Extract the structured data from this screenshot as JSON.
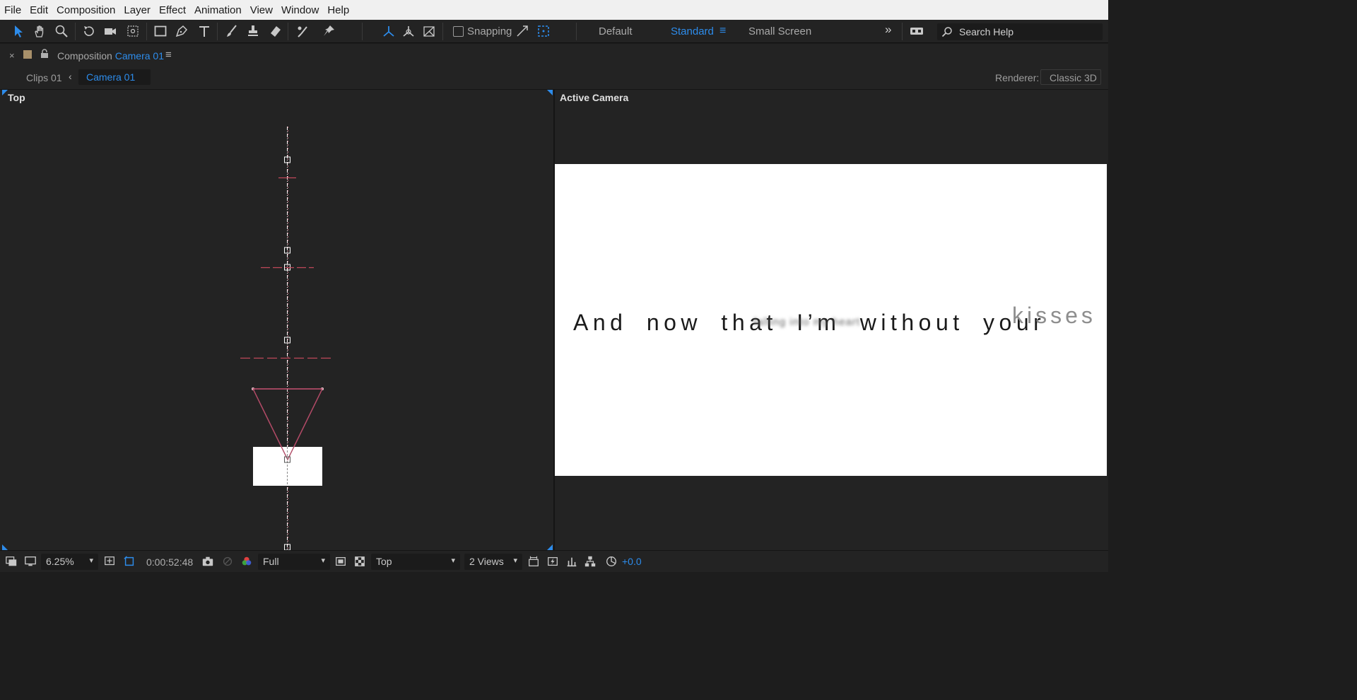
{
  "menu": [
    "File",
    "Edit",
    "Composition",
    "Layer",
    "Effect",
    "Animation",
    "View",
    "Window",
    "Help"
  ],
  "toolbar": {
    "snapping_label": "Snapping",
    "workspaces": [
      "Default",
      "Standard",
      "Small Screen"
    ],
    "active_workspace": "Standard",
    "search_placeholder": "Search Help"
  },
  "panel": {
    "title_prefix": "Composition",
    "title_name": "Camera 01",
    "breadcrumb": [
      "Clips 01",
      "Camera 01"
    ],
    "renderer_label": "Renderer:",
    "renderer_value": "Classic 3D"
  },
  "views": {
    "left_name": "Top",
    "right_name": "Active Camera"
  },
  "preview": {
    "line_main": "And now that I’m without your",
    "line_blur": "falling  into  my  heart",
    "line_kisses": "kisses"
  },
  "bottom": {
    "zoom": "6.25%",
    "timecode": "0:00:52:48",
    "resolution": "Full",
    "view": "Top",
    "layout": "2 Views",
    "exposure": "+0.0"
  },
  "colors": {
    "accent": "#2d8ceb",
    "camera_line": "#c0485a",
    "comp_bg": "#ffffff",
    "panel_bg": "#232323"
  }
}
